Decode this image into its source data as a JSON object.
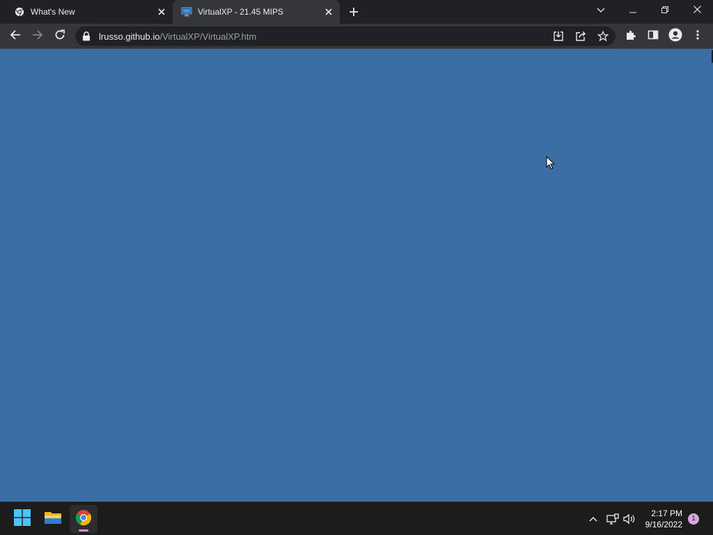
{
  "browser": {
    "tabs": [
      {
        "title": "What's New",
        "icon": "chrome-icon",
        "active": false
      },
      {
        "title": "VirtualXP - 21.45 MIPS",
        "icon": "monitor-icon",
        "active": true
      }
    ],
    "address": {
      "host": "lrusso.github.io",
      "path": "/VirtualXP/VirtualXP.htm"
    }
  },
  "taskbar": {
    "apps": [
      "windows-start-icon",
      "file-explorer-icon",
      "chrome-icon"
    ],
    "clock": {
      "time": "2:17 PM",
      "date": "9/16/2022"
    },
    "notification_count": "1"
  },
  "colors": {
    "desktop": "#3a6ea5",
    "tabstrip": "#202124",
    "toolbar": "#35363a",
    "taskbar": "#1c1c1c"
  }
}
